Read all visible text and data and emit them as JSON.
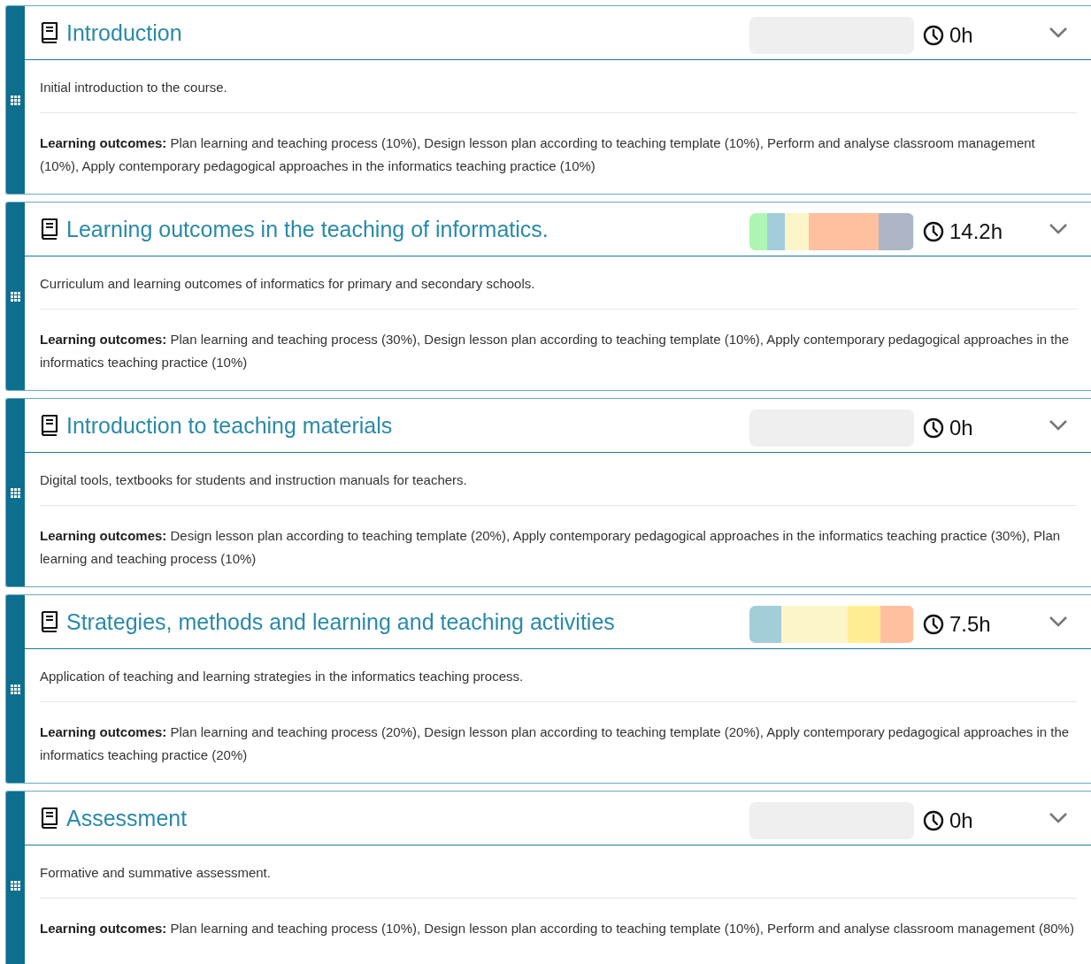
{
  "units": [
    {
      "title": "Introduction",
      "hours": "0h",
      "description": "Initial introduction to the course.",
      "outcomes": "**Learning outcomes:**  Plan learning and teaching process (10%), Design lesson plan according to teaching template (10%), Perform and analyse classroom management (10%), Apply contemporary pedagogical approaches in the informatics teaching practice (10%)"
    },
    {
      "title": "Learning outcomes in the teaching of informatics.",
      "hours": "14.2h",
      "segments": [
        {
          "color": "#aef5b4"
        },
        {
          "color": "#a3cdd9"
        },
        {
          "color": "#fcf5c7"
        },
        {
          "color": "#ffc09f"
        },
        {
          "color": "#adb6c4"
        }
      ],
      "description": "Curriculum and learning outcomes of informatics for primary and secondary schools.",
      "outcomes": "**Learning outcomes:**  Plan learning and teaching process (30%), Design lesson plan according to teaching template (10%), Apply contemporary pedagogical approaches in the informatics teaching practice (10%)"
    },
    {
      "title": "Introduction to teaching materials",
      "hours": "0h",
      "description": "Digital tools, textbooks for students and instruction manuals for teachers.",
      "outcomes": "**Learning outcomes:**  Design lesson plan according to teaching template (20%), Apply contemporary pedagogical approaches in the informatics teaching practice (30%), Plan learning and teaching process (10%)"
    },
    {
      "title": "Strategies, methods and learning and teaching activities",
      "hours": "7.5h",
      "segments": [
        {
          "color": "#a3cdd9"
        },
        {
          "color": "#fcf5c7"
        },
        {
          "color": "#ffee93"
        },
        {
          "color": "#ffc09f"
        }
      ],
      "description": "Application of teaching and learning strategies in the informatics teaching process.",
      "outcomes": "**Learning outcomes:**  Plan learning and teaching process (20%), Design lesson plan according to teaching template (20%), Apply contemporary pedagogical approaches in the informatics teaching practice (20%)"
    },
    {
      "title": "Assessment",
      "hours": "0h",
      "description": "Formative and summative assessment.",
      "outcomes": "**Learning outcomes:**  Plan learning and teaching process (10%), Design lesson plan according to teaching template (10%), Perform and analyse classroom management (80%)"
    }
  ]
}
